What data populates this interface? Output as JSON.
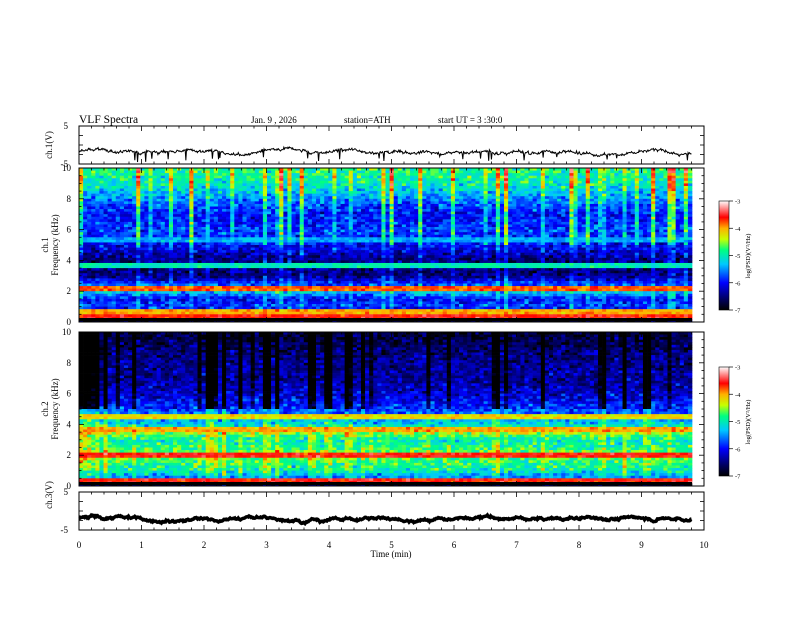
{
  "header": {
    "title": "VLF Spectra",
    "date": "Jan. 9 , 2026",
    "station": "station=ATH",
    "start_ut": "start UT =  3 :30:0"
  },
  "chart_data": [
    {
      "type": "line",
      "panel": "ch1-waveform",
      "ylabel": "ch.1(V)",
      "ylim": [
        -5,
        5
      ],
      "yticks": [
        "5",
        "-5"
      ],
      "x_range_min": [
        0,
        9.8
      ],
      "baseline_v": -1.8,
      "noise_amplitude_v": 0.6,
      "spikes_down_to_v": -4.5
    },
    {
      "type": "heatmap",
      "panel": "ch1-spectrogram",
      "ylabel": "ch.1\nFrequency (kHz)",
      "ylim": [
        0,
        10
      ],
      "yticks": [
        "0",
        "2",
        "4",
        "6",
        "8",
        "10"
      ],
      "x_range_min": [
        0,
        9.8
      ],
      "freq_profile_log_psd": [
        {
          "f": 0.0,
          "v": -7.0
        },
        {
          "f": 0.5,
          "v": -6.6
        },
        {
          "f": 1.0,
          "v": -5.8
        },
        {
          "f": 1.5,
          "v": -6.0
        },
        {
          "f": 2.0,
          "v": -5.2
        },
        {
          "f": 2.5,
          "v": -5.8
        },
        {
          "f": 3.0,
          "v": -6.5
        },
        {
          "f": 4.0,
          "v": -6.5
        },
        {
          "f": 5.0,
          "v": -6.0
        },
        {
          "f": 6.0,
          "v": -5.8
        },
        {
          "f": 7.0,
          "v": -6.0
        },
        {
          "f": 8.0,
          "v": -5.5
        },
        {
          "f": 9.0,
          "v": -5.0
        },
        {
          "f": 10.0,
          "v": -4.8
        }
      ],
      "lines_khz": [
        {
          "f": 0.35,
          "v": -3.6
        },
        {
          "f": 0.7,
          "v": -4.0
        },
        {
          "f": 2.2,
          "v": -3.8
        },
        {
          "f": 3.6,
          "v": -5.0
        },
        {
          "f": 5.3,
          "v": -5.4
        }
      ]
    },
    {
      "type": "heatmap",
      "panel": "ch2-spectrogram",
      "ylabel": "ch.2\nFrequency (kHz)",
      "ylim": [
        0,
        10
      ],
      "yticks": [
        "0",
        "2",
        "4",
        "6",
        "8",
        "10"
      ],
      "x_range_min": [
        0,
        9.8
      ],
      "freq_profile_log_psd": [
        {
          "f": 0.0,
          "v": -7.0
        },
        {
          "f": 0.5,
          "v": -5.6
        },
        {
          "f": 1.0,
          "v": -5.0
        },
        {
          "f": 2.0,
          "v": -4.6
        },
        {
          "f": 3.0,
          "v": -5.0
        },
        {
          "f": 3.5,
          "v": -4.4
        },
        {
          "f": 4.0,
          "v": -5.2
        },
        {
          "f": 5.0,
          "v": -5.8
        },
        {
          "f": 6.0,
          "v": -6.2
        },
        {
          "f": 7.0,
          "v": -6.4
        },
        {
          "f": 8.0,
          "v": -6.4
        },
        {
          "f": 9.0,
          "v": -6.6
        },
        {
          "f": 10.0,
          "v": -6.8
        }
      ],
      "lines_khz": [
        {
          "f": 0.35,
          "v": -3.6
        },
        {
          "f": 2.0,
          "v": -3.6
        },
        {
          "f": 3.6,
          "v": -4.0
        },
        {
          "f": 4.5,
          "v": -4.2
        }
      ]
    },
    {
      "type": "line",
      "panel": "ch3-waveform",
      "ylabel": "ch.3(V)",
      "ylim": [
        -5,
        5
      ],
      "yticks": [
        "5",
        "-5"
      ],
      "x_range_min": [
        0,
        9.8
      ],
      "baseline_v": -2.0,
      "noise_amplitude_v": 0.15
    }
  ],
  "x_axis": {
    "label": "Time (min)",
    "min": 0,
    "max": 10,
    "ticks": [
      "0",
      "1",
      "2",
      "3",
      "4",
      "5",
      "6",
      "7",
      "8",
      "9",
      "10"
    ]
  },
  "colorbars": [
    {
      "label": "log(PSD)(V²/Hz)",
      "ticks": [
        "-3",
        "-4",
        "-5",
        "-6",
        "-7"
      ],
      "range": [
        -7,
        -3
      ]
    },
    {
      "label": "log(PSD)(V²/Hz)",
      "ticks": [
        "-3",
        "-4",
        "-5",
        "-6",
        "-7"
      ],
      "range": [
        -7,
        -3
      ]
    }
  ],
  "colors": {
    "waveform": "#000000",
    "axis": "#000000",
    "background": "#ffffff"
  }
}
